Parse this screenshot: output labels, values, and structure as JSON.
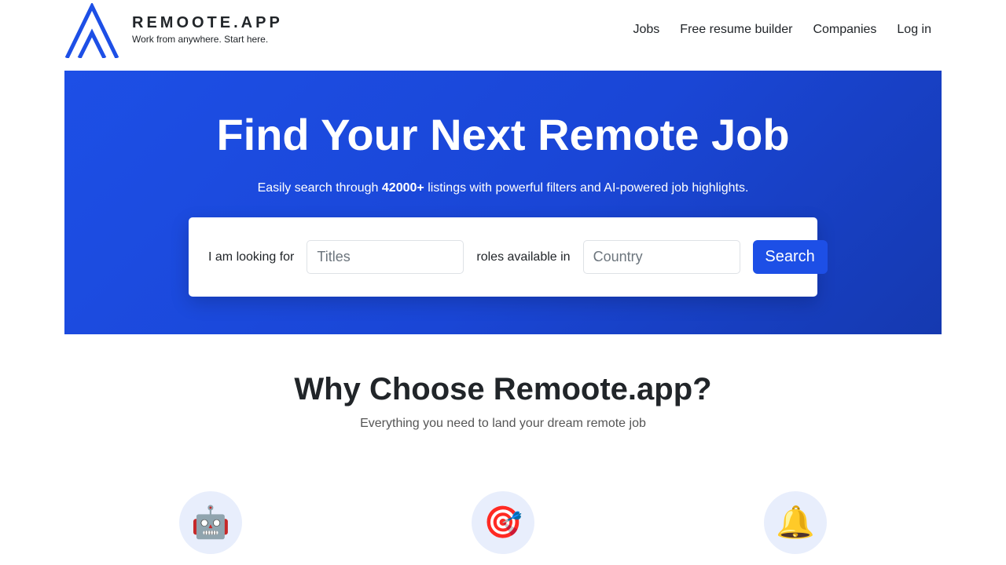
{
  "brand": {
    "name": "REMOOTE.APP",
    "tagline": "Work from anywhere. Start here.",
    "color": "#1d4fe6"
  },
  "nav": {
    "items": [
      {
        "label": "Jobs"
      },
      {
        "label": "Free resume builder"
      },
      {
        "label": "Companies"
      },
      {
        "label": "Log in"
      }
    ]
  },
  "hero": {
    "title": "Find Your Next Remote Job",
    "subtitle_before": "Easily search through ",
    "subtitle_count": "42000+",
    "subtitle_after": " listings with powerful filters and AI-powered job highlights.",
    "background_color": "#1a46d6"
  },
  "search": {
    "label_looking_for": "I am looking for",
    "titles_placeholder": "Titles",
    "titles_value": "",
    "label_roles_in": "roles available in",
    "country_placeholder": "Country",
    "country_value": "",
    "button_label": "Search"
  },
  "why": {
    "title": "Why Choose Remoote.app?",
    "subtitle": "Everything you need to land your dream remote job"
  },
  "features": [
    {
      "icon": "robot-icon",
      "glyph": "🤖"
    },
    {
      "icon": "target-icon",
      "glyph": "🎯"
    },
    {
      "icon": "bell-icon",
      "glyph": "🔔"
    }
  ]
}
